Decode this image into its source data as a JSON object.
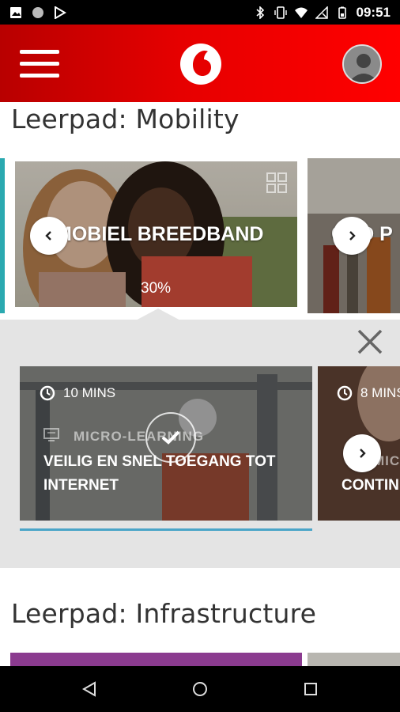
{
  "status_bar": {
    "time": "09:51",
    "left_icons": [
      "image-icon",
      "circle-icon",
      "play-store-icon"
    ],
    "right_icons": [
      "bluetooth-icon",
      "vibrate-icon",
      "wifi-icon",
      "no-signal-icon",
      "battery-icon"
    ]
  },
  "app_bar": {
    "menu_icon": "hamburger-menu-icon",
    "logo": "vodafone-logo",
    "profile_icon": "avatar-icon",
    "color": "#e60000"
  },
  "sections": [
    {
      "title": "Leerpad: Mobility",
      "cards": [
        {
          "title": "MOBIEL BREEDBAND",
          "progress": "30%"
        },
        {
          "title": "GED P"
        }
      ]
    },
    {
      "title": "Leerpad: Infrastructure"
    }
  ],
  "modules": [
    {
      "duration": "10 MINS",
      "type": "MICRO-LEARNING",
      "title_line1": "VEILIG EN SNEL TOEGANG TOT",
      "title_line2": "INTERNET",
      "completed": true
    },
    {
      "duration": "8 MINS",
      "type": "MICRO",
      "title_line1": "CONTIN"
    }
  ],
  "nav": {
    "back": "back-icon",
    "home": "home-icon",
    "recents": "recents-icon"
  }
}
